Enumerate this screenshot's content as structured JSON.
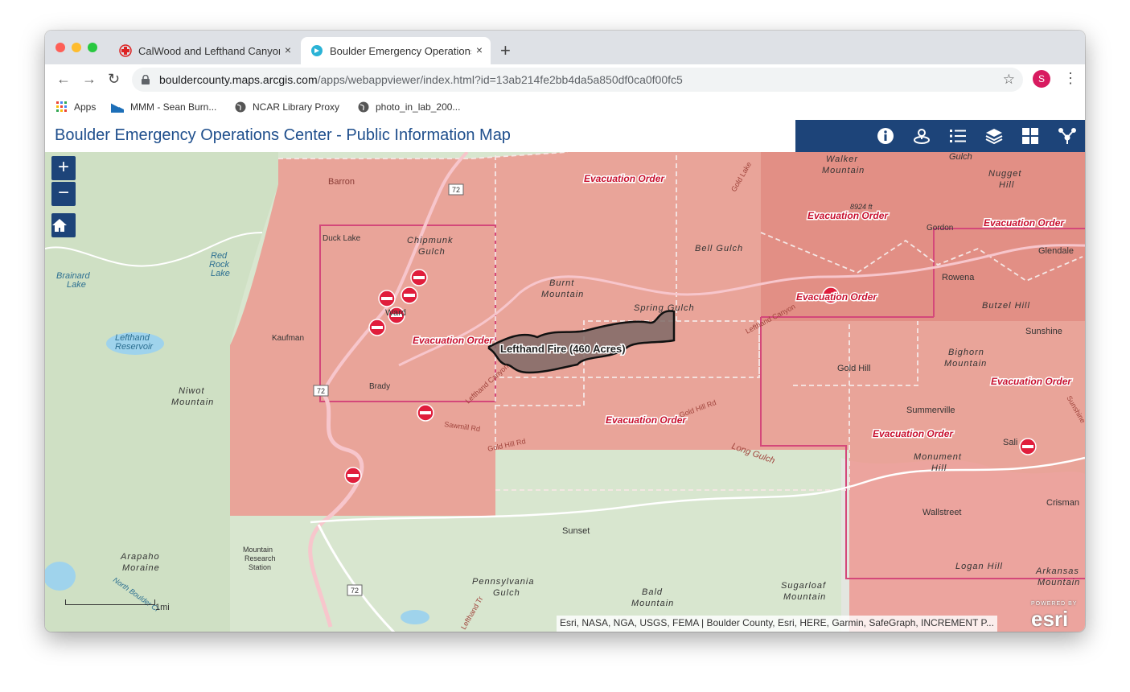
{
  "browser": {
    "tabs": [
      {
        "title": "CalWood and Lefthand Canyon",
        "close": "×"
      },
      {
        "title": "Boulder Emergency Operations",
        "close": "×"
      }
    ],
    "new_tab": "+",
    "url_host": "bouldercounty.maps.arcgis.com",
    "url_path": "/apps/webappviewer/index.html?id=13ab214fe2bb4da5a850df0ca0f00fc5",
    "profile_initial": "S",
    "bookmarks": [
      {
        "label": "Apps"
      },
      {
        "label": "MMM - Sean Burn..."
      },
      {
        "label": "NCAR Library Proxy"
      },
      {
        "label": "photo_in_lab_200..."
      }
    ]
  },
  "app": {
    "title": "Boulder Emergency Operations Center - Public Information Map",
    "widgets": [
      "info-icon",
      "locate-icon",
      "legend-list-icon",
      "layers-icon",
      "basemap-grid-icon",
      "share-icon"
    ]
  },
  "map": {
    "zoom_in": "+",
    "zoom_out": "−",
    "fire_label": "Lefthand Fire (460 Acres)",
    "evacuation_label": "Evacuation Order",
    "scale_label": "1mi",
    "attribution": "Esri, NASA, NGA, USGS, FEMA | Boulder County, Esri, HERE, Garmin, SafeGraph, INCREMENT P...",
    "esri_small": "POWERED BY",
    "esri_logo": "esri",
    "places": {
      "barron": "Barron",
      "duck_lake": "Duck Lake",
      "chipmunk": "Chipmunk",
      "gulch": "Gulch",
      "red": "Red",
      "rock": "Rock",
      "lake": "Lake",
      "brainard": "Brainard",
      "brainard_lake": "Lake",
      "lefthand": "Lefthand",
      "reservoir": "Reservoir",
      "kaufman": "Kaufman",
      "ward": "Ward",
      "brady": "Brady",
      "niwot": "Niwot",
      "mountain": "Mountain",
      "burnt": "Burnt",
      "burnt_mountain": "Mountain",
      "bell_gulch": "Bell Gulch",
      "spring_gulch": "Spring Gulch",
      "walker": "Walker",
      "walker_mountain": "Mountain",
      "elev": "8924 ft",
      "gordon": "Gordon",
      "gulch_top": "Gulch",
      "nugget": "Nugget",
      "hill": "Hill",
      "glendale": "Glendale",
      "rowena": "Rowena",
      "butzel_hill": "Butzel Hill",
      "sunshine": "Sunshine",
      "gold_hill": "Gold Hill",
      "bighorn": "Bighorn",
      "bighorn_mountain": "Mountain",
      "summerville": "Summerville",
      "monument": "Monument",
      "monument_hill": "Hill",
      "salina": "Sali",
      "crisman": "Crisman",
      "wallstreet": "Wallstreet",
      "logan_hill": "Logan Hill",
      "arkansas": "Arkansas",
      "arkansas_mountain": "Mountain",
      "sugarloaf": "Sugarloaf",
      "sugarloaf_mountain": "Mountain",
      "bald": "Bald",
      "bald_mountain": "Mountain",
      "pennsylvania": "Pennsylvania",
      "pennsylvania_gulch": "Gulch",
      "sunset": "Sunset",
      "arapaho": "Arapaho",
      "moraine": "Moraine",
      "mtn_research": "Mountain",
      "research": "Research",
      "station": "Station",
      "sawmill_rd": "Sawmill Rd",
      "gold_hill_rd": "Gold Hill Rd",
      "gold_hill_rd2": "Gold Hill Rd",
      "long_gulch": "Long Gulch",
      "lefthand_canyon": "Lefthand Canyon",
      "lefthand_canyon2": "Lefthand Canyon",
      "gold_lake": "Gold Lake",
      "sunshine_rd": "Sunshine",
      "north_boulder": "North Boulder Cr",
      "lefthand_tr": "Lefthand Tr",
      "hwy72": "72"
    }
  }
}
